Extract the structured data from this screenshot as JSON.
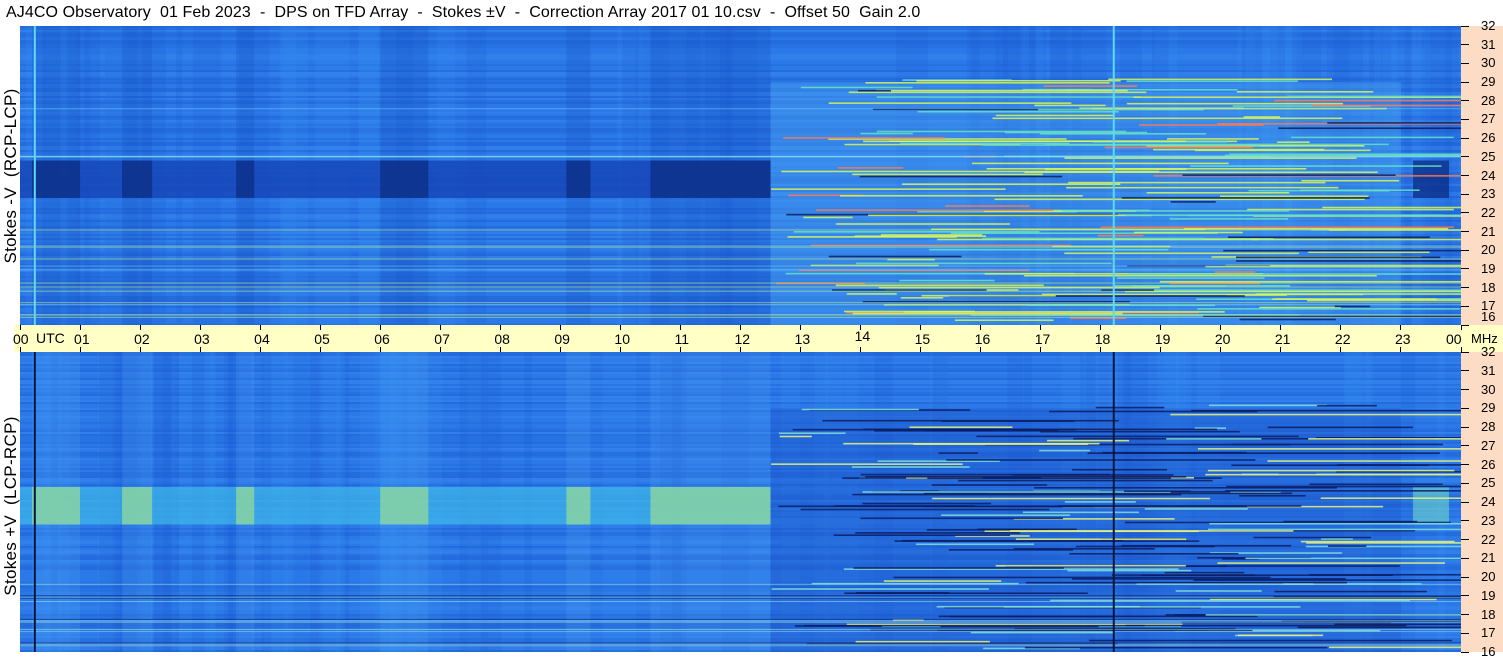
{
  "title": "AJ4CO Observatory  01 Feb 2023  -  DPS on TFD Array  -  Stokes ±V  -  Correction Array 2017 01 10.csv  -  Offset 50  Gain 2.0",
  "colors": {
    "background_blue": "#1f6de0",
    "dark_band": "#0a2a8a",
    "bright_band": "#b9f07a",
    "utc_bar": "#ffffc6",
    "freq_strip": "#fcdcc4"
  },
  "chart_data": [
    {
      "type": "heatmap",
      "name": "top",
      "ylabel": "Stokes -V  (RCP-LCP)",
      "x_unit": "UTC",
      "y_unit": "MHz",
      "xlim": [
        0,
        24
      ],
      "ylim": [
        16,
        32
      ],
      "x_ticks": [
        "00",
        "01",
        "02",
        "03",
        "04",
        "05",
        "06",
        "07",
        "08",
        "09",
        "10",
        "11",
        "12",
        "13",
        "14",
        "15",
        "16",
        "17",
        "18",
        "19",
        "20",
        "21",
        "22",
        "23",
        "00"
      ],
      "y_ticks": [
        16,
        17,
        18,
        19,
        20,
        21,
        22,
        23,
        24,
        25,
        26,
        27,
        28,
        29,
        30,
        31,
        32
      ],
      "dark_blocks_hours": [
        [
          0.2,
          1.0
        ],
        [
          1.7,
          2.2
        ],
        [
          3.6,
          3.9
        ],
        [
          6.0,
          6.8
        ],
        [
          9.1,
          9.5
        ],
        [
          10.5,
          12.5
        ]
      ],
      "band_mhz": [
        22.8,
        24.8
      ],
      "rfi_region_hours": [
        12.5,
        23.0
      ]
    },
    {
      "type": "heatmap",
      "name": "bottom",
      "ylabel": "Stokes +V  (LCP-RCP)",
      "x_unit": "UTC",
      "y_unit": "MHz",
      "xlim": [
        0,
        24
      ],
      "ylim": [
        16,
        32
      ],
      "x_ticks": [
        "00",
        "01",
        "02",
        "03",
        "04",
        "05",
        "06",
        "07",
        "08",
        "09",
        "10",
        "11",
        "12",
        "13",
        "14",
        "15",
        "16",
        "17",
        "18",
        "19",
        "20",
        "21",
        "22",
        "23",
        "00"
      ],
      "y_ticks": [
        16,
        17,
        18,
        19,
        20,
        21,
        22,
        23,
        24,
        25,
        26,
        27,
        28,
        29,
        30,
        31,
        32
      ],
      "bright_blocks_hours": [
        [
          0.2,
          1.0
        ],
        [
          1.7,
          2.2
        ],
        [
          3.6,
          3.9
        ],
        [
          6.0,
          6.8
        ],
        [
          9.1,
          9.5
        ],
        [
          10.5,
          12.5
        ]
      ],
      "band_mhz": [
        22.8,
        24.8
      ],
      "rfi_region_hours": [
        12.5,
        23.0
      ]
    }
  ],
  "axis": {
    "utc_label": "UTC",
    "mhz_label": "MHz"
  }
}
